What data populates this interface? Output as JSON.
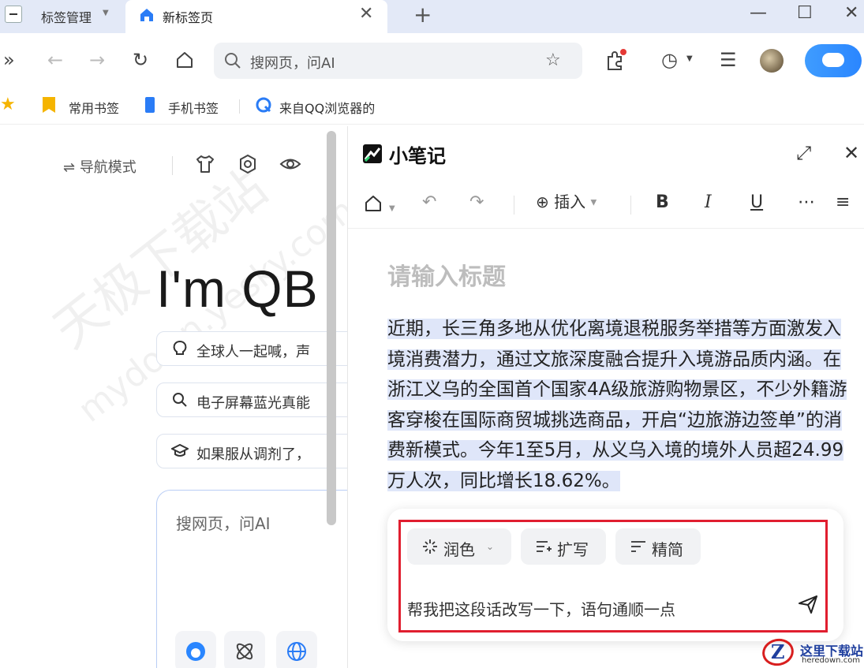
{
  "tabs": {
    "inactive_label": "标签管理",
    "active_label": "新标签页"
  },
  "toolbar": {
    "address_placeholder": "搜网页，问AI"
  },
  "bookmarks": {
    "items": [
      {
        "label": "常用书签",
        "icon": "bookmark-star-icon"
      },
      {
        "label": "手机书签",
        "icon": "phone-icon"
      },
      {
        "label": "来自QQ浏览器的",
        "icon": "qq-browser-icon"
      }
    ]
  },
  "newtab": {
    "nav_mode_label": "导航模式",
    "big_title": "I'm QB",
    "pills": [
      {
        "text": "全球人一起喊，声",
        "icon": "bulb-icon"
      },
      {
        "text": "电子屏幕蓝光真能",
        "icon": "search-icon"
      },
      {
        "text": "如果服从调剂了，",
        "icon": "graduation-cap-icon"
      }
    ],
    "search_placeholder": "搜网页，问AI",
    "watermark_1": "天极下载站",
    "watermark_2": "mydown.yesky.com"
  },
  "notes": {
    "app_title": "小笔记",
    "insert_label": "插入",
    "doc_title_placeholder": "请输入标题",
    "body_text": "近期，长三角多地从优化离境退税服务举措等方面激发入境消费潜力，通过文旅深度融合提升入境游品质内涵。在浙江义乌的全国首个国家4A级旅游购物景区，不少外籍游客穿梭在国际商贸城挑选商品，开启“边旅游边签单”的消费新模式。今年1至5月，从义乌入境的境外人员超24.99万人次，同比增长18.62%。",
    "ai": {
      "chips": [
        "润色",
        "扩写",
        "精简"
      ],
      "input_value": "帮我把这段话改写一下，语句通顺一点"
    }
  },
  "stamp": {
    "letter": "Z",
    "name": "这里下载站",
    "domain": "heredown.com"
  },
  "colors": {
    "tabbar_bg": "#e3e9f7",
    "accent_blue": "#2a86ff",
    "highlight": "#dfe6f9",
    "annotation_red": "#e01e2f"
  }
}
